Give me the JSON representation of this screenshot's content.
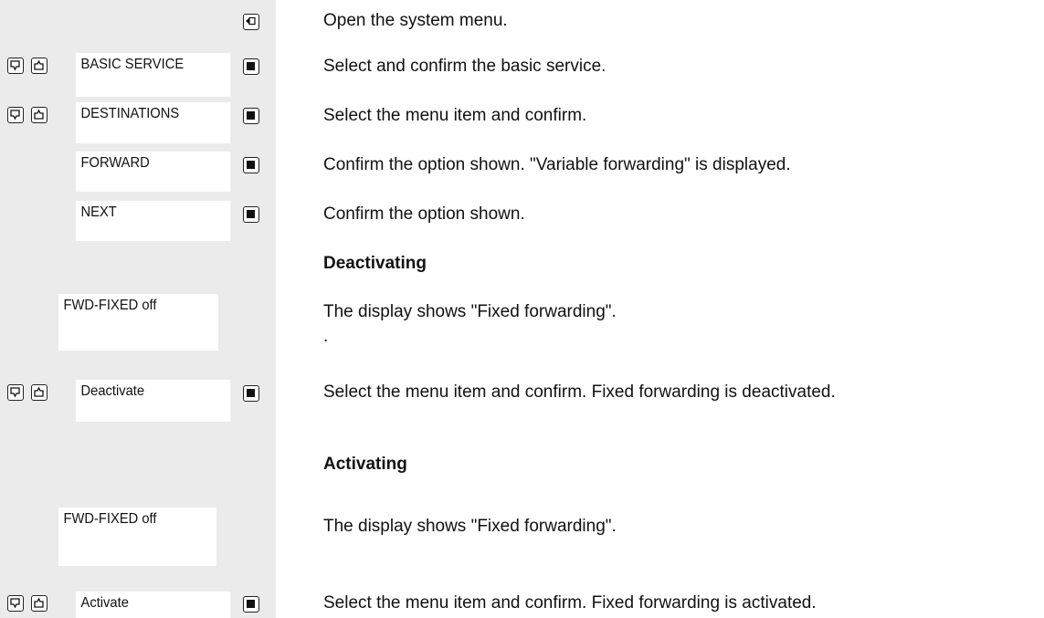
{
  "rows": {
    "r1": {
      "instruction": "Open the system menu."
    },
    "r2": {
      "display": "BASIC SERVICE",
      "instruction": "Select and confirm the basic service."
    },
    "r3": {
      "display": "DESTINATIONS",
      "instruction": "Select the menu item and confirm."
    },
    "r4": {
      "display": "FORWARD",
      "instruction": "Confirm the option shown. \"Variable forwarding\" is displayed."
    },
    "r5": {
      "display": "NEXT",
      "instruction": "Confirm the option shown."
    },
    "deact": {
      "heading": "Deactivating",
      "display_status": "FWD-FIXED off",
      "status_text": "The display shows \"Fixed forwarding\".",
      "dot": ".",
      "option": "Deactivate",
      "option_text": "Select the menu item and confirm. Fixed forwarding is deactivated."
    },
    "act": {
      "heading": "Activating",
      "display_status": "FWD-FIXED off",
      "status_text": "The display shows \"Fixed forwarding\".",
      "option": "Activate",
      "option_text": "Select the menu item and confirm. Fixed forwarding is activated."
    }
  },
  "icons": {
    "menu_key": "menu-key-icon",
    "confirm_key": "ok-key-icon",
    "down_key": "down-arrow-key-icon",
    "up_key": "up-arrow-key-icon"
  }
}
